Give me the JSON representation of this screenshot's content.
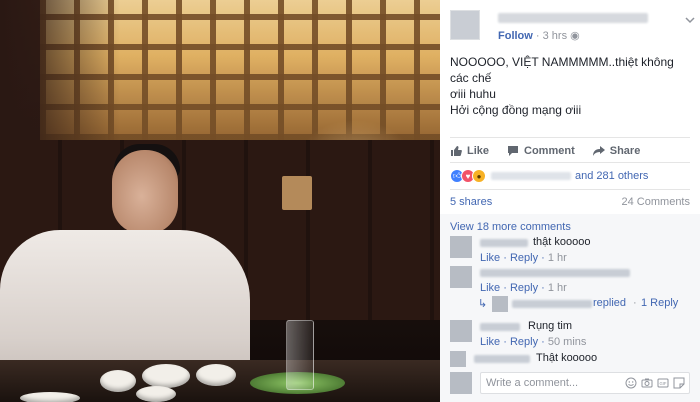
{
  "post": {
    "time": "3 hrs",
    "follow": "Follow",
    "text_line1": "NOOOOO, VIỆT NAMMMMM..thiệt không các chế",
    "text_line2": "ơiii huhu",
    "text_line3": "Hởi cộng đồng mạng ơiii"
  },
  "actions": {
    "like": "Like",
    "comment": "Comment",
    "share": "Share"
  },
  "reactions": {
    "others": "and 281 others",
    "icons": [
      "like-icon",
      "love-icon",
      "wow-icon"
    ]
  },
  "stats": {
    "shares": "5 shares",
    "comments": "24 Comments"
  },
  "comments": {
    "view_more": "View 18 more comments",
    "items": [
      {
        "text": "thật kooooo",
        "like": "Like",
        "reply": "Reply",
        "time": "1 hr"
      },
      {
        "text": "",
        "like": "Like",
        "reply": "Reply",
        "time": "1 hr"
      },
      {
        "text": "Rụng tim",
        "like": "Like",
        "reply": "Reply",
        "time": "50 mins"
      },
      {
        "text": "Thật kooooo"
      }
    ],
    "replied": "replied",
    "reply_count": "1 Reply"
  },
  "composer": {
    "placeholder": "Write a comment..."
  },
  "colors": {
    "link": "#4267b2",
    "muted": "#90949c",
    "panel_bg": "#ffffff",
    "comments_bg": "#f6f7f9"
  }
}
